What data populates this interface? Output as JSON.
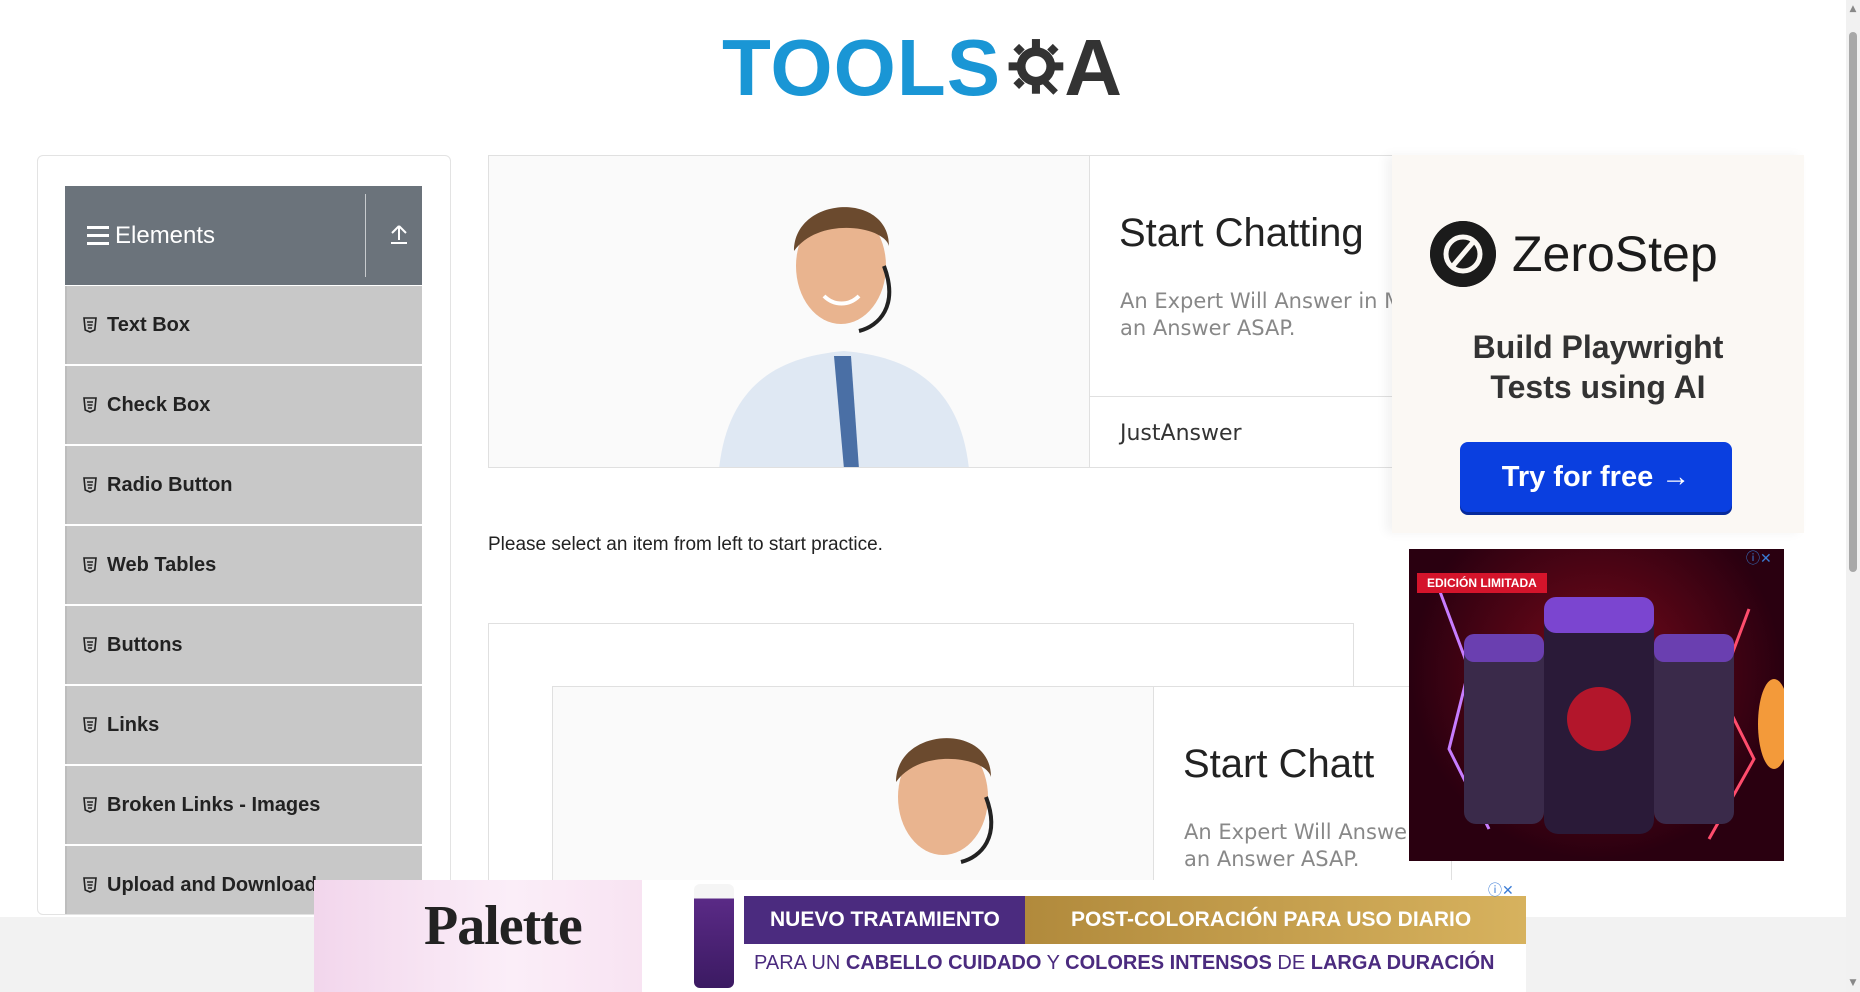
{
  "logo": {
    "tools": "TOOLS",
    "qa": "A"
  },
  "sidebar": {
    "group_title": "Elements",
    "items": [
      {
        "label": "Text Box"
      },
      {
        "label": "Check Box"
      },
      {
        "label": "Radio Button"
      },
      {
        "label": "Web Tables"
      },
      {
        "label": "Buttons"
      },
      {
        "label": "Links"
      },
      {
        "label": "Broken Links - Images"
      },
      {
        "label": "Upload and Download"
      }
    ]
  },
  "ad1": {
    "title": "Start Chatting",
    "subtitle_line1": "An Expert Will Answer in Mi",
    "subtitle_line2": "an Answer ASAP.",
    "brand": "JustAnswer"
  },
  "practice_text": "Please select an item from left to start practice.",
  "ad2": {
    "title": "Start Chatt",
    "subtitle_line1": "An Expert Will Answe",
    "subtitle_line2": "an Answer ASAP."
  },
  "zerostep": {
    "name": "ZeroStep",
    "tagline_line1": "Build Playwright",
    "tagline_line2": "Tests using AI",
    "cta": "Try for free →"
  },
  "trident": {
    "badge": "EDICIÓN LIMITADA"
  },
  "palette": {
    "brand": "Palette",
    "band1": "NUEVO TRATAMIENTO",
    "band2": "POST-COLORACIÓN PARA USO DIARIO",
    "line_part1": "PARA UN ",
    "line_bold1": "CABELLO CUIDADO",
    "line_part2": " Y ",
    "line_bold2": "COLORES INTENSOS",
    "line_part3": " DE ",
    "line_bold3": "LARGA DURACIÓN"
  },
  "colors": {
    "brand_blue": "#1a96d5",
    "sidebar_header": "#6b737b",
    "sidebar_item": "#c8c8c8",
    "cta_blue": "#0a3fe0"
  }
}
